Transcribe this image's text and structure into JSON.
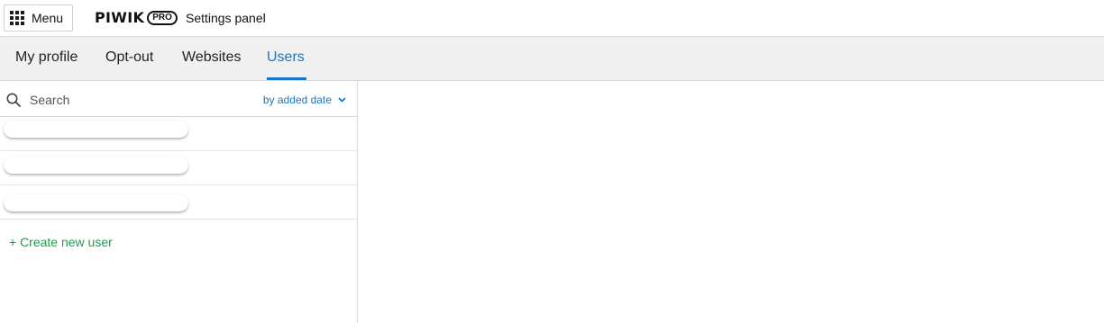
{
  "header": {
    "menu_label": "Menu",
    "logo_word": "PIWIK",
    "logo_badge": "PRO",
    "app_title": "Settings panel"
  },
  "tabs": [
    {
      "label": "My profile",
      "active": false
    },
    {
      "label": "Opt-out",
      "active": false
    },
    {
      "label": "Websites",
      "active": false
    },
    {
      "label": "Users",
      "active": true
    }
  ],
  "sidebar": {
    "search": {
      "placeholder": "Search",
      "value": ""
    },
    "sort_label": "by added date",
    "users": [
      {
        "name": ""
      },
      {
        "name": ""
      },
      {
        "name": ""
      }
    ],
    "create_label": "+ Create new user"
  },
  "colors": {
    "accent": "#1a73c8",
    "create": "#1aa04a",
    "tabbar_bg": "#f0f0f0"
  },
  "icons": [
    "grid-menu-icon",
    "search-icon",
    "chevron-down-icon"
  ]
}
